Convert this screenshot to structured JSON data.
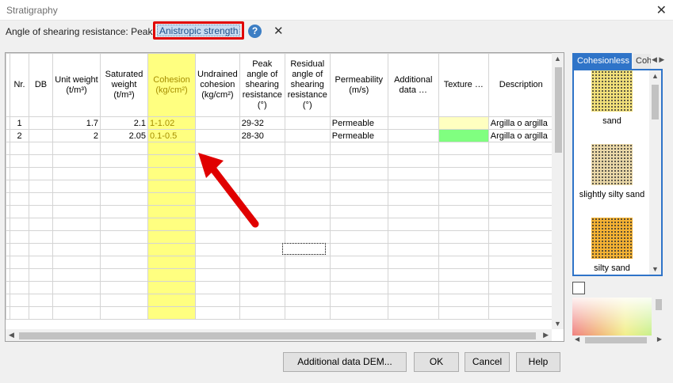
{
  "window": {
    "title": "Stratigraphy",
    "close_glyph": "✕"
  },
  "toolbar": {
    "label": "Angle of shearing resistance: Peak",
    "anisotropic_label": "Anistropic strength",
    "help_glyph": "?",
    "close_glyph": "✕"
  },
  "grid": {
    "columns": [
      {
        "label": "Nr.",
        "highlight": false
      },
      {
        "label": "DB",
        "highlight": false
      },
      {
        "label": "Unit weight (t/m³)",
        "highlight": false
      },
      {
        "label": "Saturated weight (t/m³)",
        "highlight": false
      },
      {
        "label": "Cohesion (kg/cm²)",
        "highlight": true
      },
      {
        "label": "Undrained cohesion (kg/cm²)",
        "highlight": false
      },
      {
        "label": "Peak angle of shearing resistance (°)",
        "highlight": false
      },
      {
        "label": "Residual angle of shearing resistance (°)",
        "highlight": false
      },
      {
        "label": "Permeability (m/s)",
        "highlight": false
      },
      {
        "label": "Additional data …",
        "highlight": false
      },
      {
        "label": "Texture …",
        "highlight": false
      },
      {
        "label": "Description",
        "highlight": false
      }
    ],
    "rows": [
      {
        "nr": "1",
        "db": "",
        "unit_weight": "1.7",
        "saturated_weight": "2.1",
        "cohesion": "1-1.02",
        "undrained_cohesion": "",
        "peak_angle": "29-32",
        "residual_angle": "",
        "permeability": "Permeable",
        "additional": "",
        "texture_color": "#ffffc0",
        "description": "Argilla o argilla"
      },
      {
        "nr": "2",
        "db": "",
        "unit_weight": "2",
        "saturated_weight": "2.05",
        "cohesion": "0.1-0.5",
        "undrained_cohesion": "",
        "peak_angle": "28-30",
        "residual_angle": "",
        "permeability": "Permeable",
        "additional": "",
        "texture_color": "#80ff80",
        "description": "Argilla o argilla"
      }
    ],
    "empty_rows": 14,
    "highlight_color": "#ffff80"
  },
  "textures": {
    "tabs": [
      "Cohesionless",
      "Cohesive"
    ],
    "active_tab": "Cohesionless",
    "items": [
      {
        "label": "sand",
        "color": "#f2e07a"
      },
      {
        "label": "slightly silty sand",
        "color": "#ead8a8"
      },
      {
        "label": "silty sand",
        "color": "#f5b233"
      }
    ]
  },
  "buttons": {
    "additional_data": "Additional data DEM...",
    "ok": "OK",
    "cancel": "Cancel",
    "help": "Help"
  },
  "colors": {
    "annotation_red": "#e00000",
    "tab_blue": "#2f74c8"
  }
}
